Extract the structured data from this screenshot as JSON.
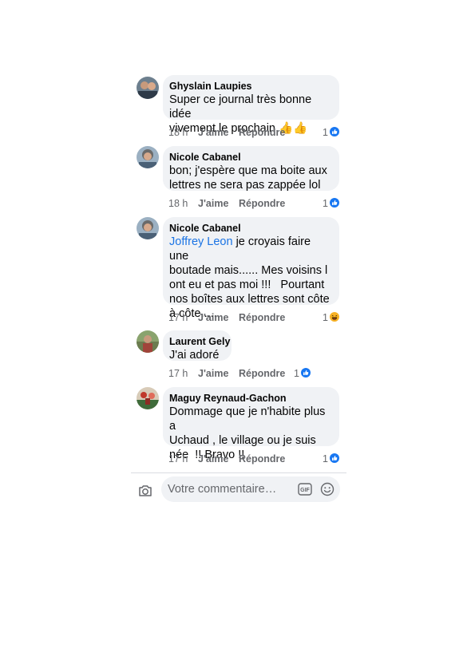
{
  "comments": [
    {
      "author": "Ghyslain Laupies",
      "lines": [
        "Super ce journal très bonne idée",
        "vivement le prochain 👍👍"
      ],
      "time": "18 h",
      "like": "J'aime",
      "reply": "Répondre",
      "reaction_count": "1",
      "reaction_icon": "like-reaction-icon"
    },
    {
      "author": "Nicole Cabanel",
      "lines": [
        "bon; j'espère que ma boite aux",
        "lettres ne sera pas zappée lol"
      ],
      "time": "18 h",
      "like": "J'aime",
      "reply": "Répondre",
      "reaction_count": "1",
      "reaction_icon": "like-reaction-icon"
    },
    {
      "author": "Nicole Cabanel",
      "mention": "Joffrey Leon",
      "first_line_rest": " je croyais faire une",
      "lines": [
        "boutade mais...... Mes voisins l",
        "ont eu et pas moi !!!   Pourtant",
        "nos boîtes aux lettres sont côte",
        "à côte....."
      ],
      "time": "17 h",
      "like": "J'aime",
      "reply": "Répondre",
      "reaction_count": "1",
      "reaction_icon": "haha-reaction-icon"
    },
    {
      "author": "Laurent Gely",
      "lines": [
        "J'ai adoré"
      ],
      "time": "17 h",
      "like": "J'aime",
      "reply": "Répondre",
      "reaction_count": "1",
      "reaction_icon": "like-reaction-icon"
    },
    {
      "author": "Maguy Reynaud-Gachon",
      "lines": [
        "Dommage que je n'habite plus a",
        "Uchaud , le village ou je suis",
        "née  !! Bravo !!"
      ],
      "time": "17 h",
      "like": "J'aime",
      "reply": "Répondre",
      "reaction_count": "1",
      "reaction_icon": "like-reaction-icon"
    }
  ],
  "composer": {
    "placeholder": "Votre commentaire…",
    "gif_label": "GIF",
    "icons": [
      "camera-icon",
      "gif-icon",
      "smiley-icon"
    ]
  },
  "colors": {
    "bubble": "#f0f2f5",
    "meta_text": "#65676b",
    "mention": "#1b74e4",
    "like_blue": "#1877f2",
    "haha_yellow": "#f7b125"
  }
}
